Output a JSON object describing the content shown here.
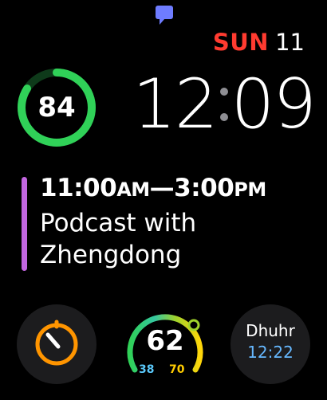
{
  "notification": {
    "icon": "message-bubble-icon",
    "color": "#6e7cff"
  },
  "date": {
    "weekday": "SUN",
    "day": "11",
    "weekday_color": "#ff3b30"
  },
  "ring_complication": {
    "value": "84",
    "fraction": 0.84,
    "color": "#30d158"
  },
  "time": {
    "hours": "12",
    "minutes": "09"
  },
  "event": {
    "start": "11:00",
    "start_suffix": "AM",
    "dash": "—",
    "end": "3:00",
    "end_suffix": "PM",
    "title": "Podcast with Zhengdong",
    "accent": "#c266e0"
  },
  "timer_complication": {
    "icon": "timer-icon",
    "color": "#ff9500"
  },
  "aqi_complication": {
    "value": "62",
    "low": "38",
    "high": "70",
    "fraction": 0.62
  },
  "prayer_complication": {
    "name": "Dhuhr",
    "time": "12:22"
  }
}
